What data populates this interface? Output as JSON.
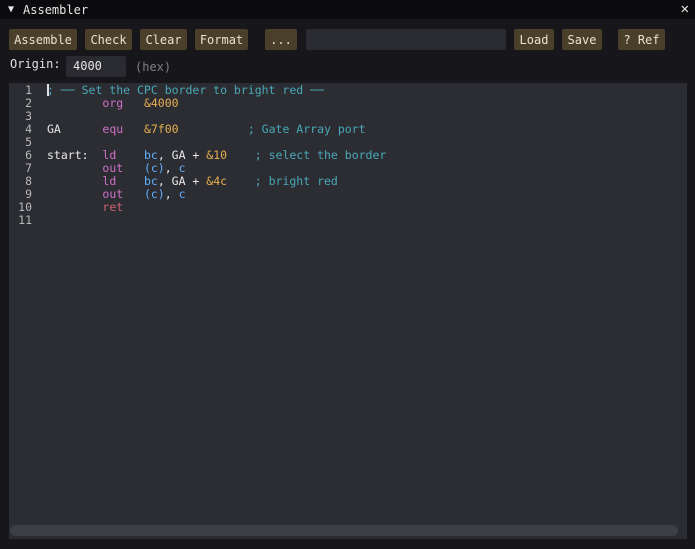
{
  "window": {
    "title": "Assembler",
    "collapse_icon": "triangle-down-icon",
    "close_icon": "close-icon"
  },
  "toolbar": {
    "assemble": "Assemble",
    "check": "Check",
    "clear": "Clear",
    "format": "Format",
    "browse": "...",
    "path_value": "",
    "load": "Load",
    "save": "Save",
    "ref": "? Ref"
  },
  "origin": {
    "label": "Origin:",
    "value": "4000",
    "hint": "(hex)"
  },
  "editor": {
    "lines": [
      {
        "n": "1",
        "tokens": [
          {
            "t": "; ── Set the CPC border to bright red ──",
            "c": "comment"
          }
        ]
      },
      {
        "n": "2",
        "tokens": [
          {
            "t": "        ",
            "c": "plain"
          },
          {
            "t": "org",
            "c": "kw"
          },
          {
            "t": "   ",
            "c": "plain"
          },
          {
            "t": "&4000",
            "c": "num"
          }
        ]
      },
      {
        "n": "3",
        "tokens": []
      },
      {
        "n": "4",
        "tokens": [
          {
            "t": "GA      ",
            "c": "plain"
          },
          {
            "t": "equ",
            "c": "kw"
          },
          {
            "t": "   ",
            "c": "plain"
          },
          {
            "t": "&7f00",
            "c": "num"
          },
          {
            "t": "          ",
            "c": "plain"
          },
          {
            "t": "; Gate Array port",
            "c": "comment"
          }
        ]
      },
      {
        "n": "5",
        "tokens": []
      },
      {
        "n": "6",
        "tokens": [
          {
            "t": "start:  ",
            "c": "plain"
          },
          {
            "t": "ld",
            "c": "kw"
          },
          {
            "t": "    ",
            "c": "plain"
          },
          {
            "t": "bc",
            "c": "reg"
          },
          {
            "t": ", GA + ",
            "c": "plain"
          },
          {
            "t": "&10",
            "c": "num"
          },
          {
            "t": "    ",
            "c": "plain"
          },
          {
            "t": "; select the border",
            "c": "comment"
          }
        ]
      },
      {
        "n": "7",
        "tokens": [
          {
            "t": "        ",
            "c": "plain"
          },
          {
            "t": "out",
            "c": "kw"
          },
          {
            "t": "   ",
            "c": "plain"
          },
          {
            "t": "(c)",
            "c": "reg"
          },
          {
            "t": ", ",
            "c": "plain"
          },
          {
            "t": "c",
            "c": "reg"
          }
        ]
      },
      {
        "n": "8",
        "tokens": [
          {
            "t": "        ",
            "c": "plain"
          },
          {
            "t": "ld",
            "c": "kw"
          },
          {
            "t": "    ",
            "c": "plain"
          },
          {
            "t": "bc",
            "c": "reg"
          },
          {
            "t": ", GA + ",
            "c": "plain"
          },
          {
            "t": "&4c",
            "c": "num"
          },
          {
            "t": "    ",
            "c": "plain"
          },
          {
            "t": "; bright red",
            "c": "comment"
          }
        ]
      },
      {
        "n": "9",
        "tokens": [
          {
            "t": "        ",
            "c": "plain"
          },
          {
            "t": "out",
            "c": "kw"
          },
          {
            "t": "   ",
            "c": "plain"
          },
          {
            "t": "(c)",
            "c": "reg"
          },
          {
            "t": ", ",
            "c": "plain"
          },
          {
            "t": "c",
            "c": "reg"
          }
        ]
      },
      {
        "n": "10",
        "tokens": [
          {
            "t": "        ",
            "c": "plain"
          },
          {
            "t": "ret",
            "c": "ret"
          }
        ]
      },
      {
        "n": "11",
        "tokens": []
      }
    ]
  },
  "colors": {
    "button_bg": "#4a3f28",
    "editor_bg": "#2b2d33",
    "comment": "#4aa8b8",
    "keyword": "#d070c8",
    "register": "#60b0ff",
    "number": "#e8b050"
  }
}
